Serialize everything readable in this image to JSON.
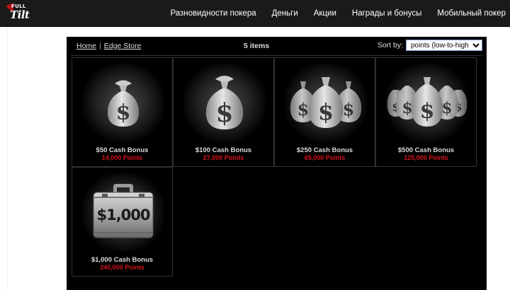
{
  "nav": {
    "logo_top": "FULL",
    "logo_main": "Tilt",
    "items": [
      {
        "label": "Разновидности покера"
      },
      {
        "label": "Деньги"
      },
      {
        "label": "Акции"
      },
      {
        "label": "Награды и бонусы"
      },
      {
        "label": "Мобильный покер"
      }
    ]
  },
  "store": {
    "breadcrumb": {
      "home": "Home",
      "separator": "|",
      "current": "Edge Store"
    },
    "item_count": "5 items",
    "sort_label": "Sort by:",
    "sort_selected": "points (low-to-high)",
    "items": [
      {
        "name": "$50 Cash Bonus",
        "points": "14,000 Points",
        "icon": "money-bag-icon"
      },
      {
        "name": "$100 Cash Bonus",
        "points": "27,000 Points",
        "icon": "money-bag-icon"
      },
      {
        "name": "$250 Cash Bonus",
        "points": "65,000 Points",
        "icon": "money-bags-three-icon"
      },
      {
        "name": "$500 Cash Bonus",
        "points": "125,000 Points",
        "icon": "money-bags-many-icon"
      },
      {
        "name": "$1,000 Cash Bonus",
        "points": "240,000 Points",
        "icon": "briefcase-icon",
        "case_label": "$1,000"
      }
    ]
  }
}
